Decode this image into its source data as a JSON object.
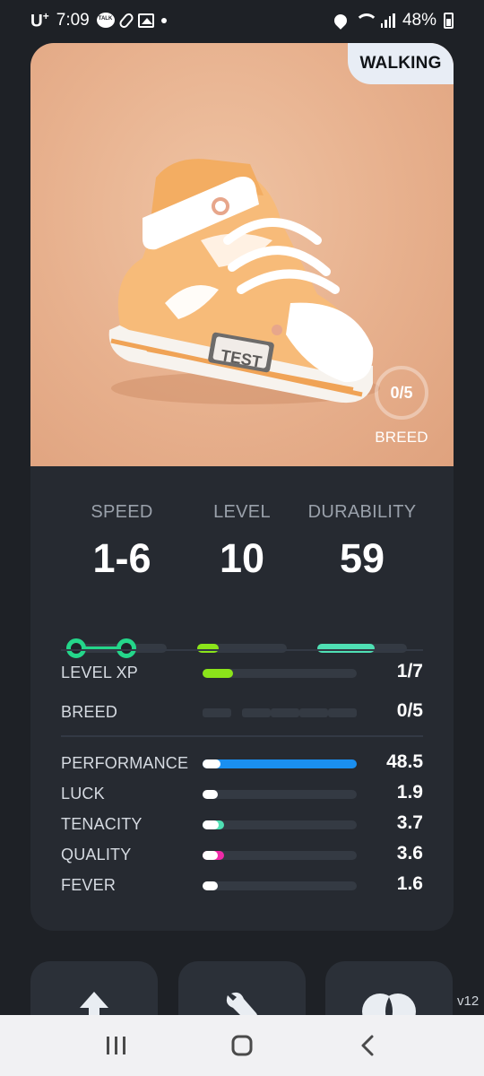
{
  "status_bar": {
    "carrier": "U",
    "carrier_sup": "+",
    "time": "7:09",
    "battery": "48%"
  },
  "card": {
    "mode_badge": "WALKING",
    "breed_ring_value": "0/5",
    "breed_ring_caption": "BREED",
    "shoe_tag_text": "TEST",
    "top_stats": [
      {
        "label": "SPEED",
        "value": "1-6",
        "range_low": 1,
        "range_high": 6,
        "color": "#24d68a"
      },
      {
        "label": "LEVEL",
        "value": "10",
        "fill_fraction": 0.24,
        "color": "#8be41a"
      },
      {
        "label": "DURABILITY",
        "value": "59",
        "fill_fraction": 0.64,
        "color": "#4fe0b4"
      }
    ],
    "progress_rows": [
      {
        "label": "LEVEL XP",
        "value": "1/7",
        "fill_fraction": 0.2,
        "color": "#8be41a"
      },
      {
        "label": "BREED",
        "value": "0/5",
        "segments": 5
      }
    ],
    "attributes": [
      {
        "label": "PERFORMANCE",
        "value": "48.5",
        "fill_fraction": 1.0,
        "color": "#1a8ff0"
      },
      {
        "label": "LUCK",
        "value": "1.9",
        "fill_fraction": 0.1,
        "color": "#ffffff"
      },
      {
        "label": "TENACITY",
        "value": "3.7",
        "fill_fraction": 0.14,
        "color": "#4fe0b4"
      },
      {
        "label": "QUALITY",
        "value": "3.6",
        "fill_fraction": 0.14,
        "color": "#f02aa8"
      },
      {
        "label": "FEVER",
        "value": "1.6",
        "fill_fraction": 0.1,
        "color": "#ffffff"
      }
    ]
  },
  "bottom_tiles": [
    {
      "icon": "level-up-arrow-icon"
    },
    {
      "icon": "wrench-icon"
    },
    {
      "icon": "mint-icon"
    }
  ],
  "version": "v12",
  "nav": {
    "icons": [
      "recents-icon",
      "home-icon",
      "back-icon"
    ]
  }
}
